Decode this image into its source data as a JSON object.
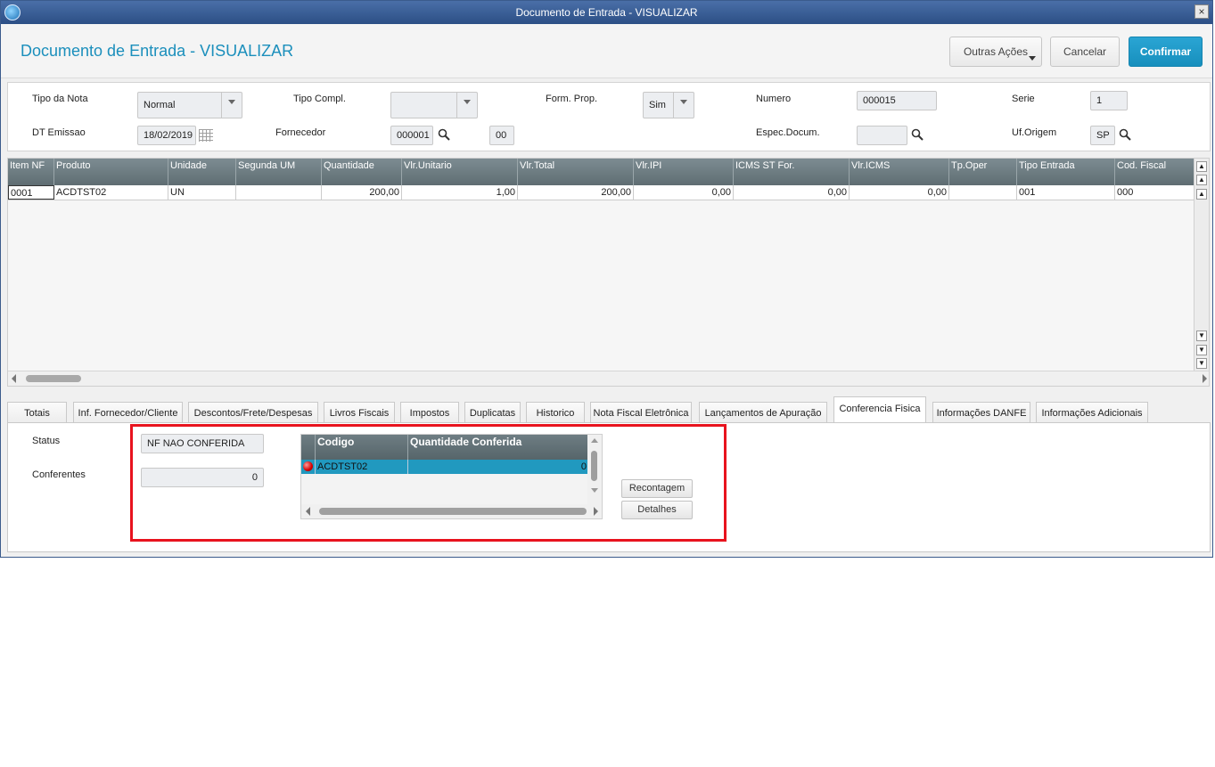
{
  "window": {
    "title": "Documento de Entrada - VISUALIZAR",
    "close_glyph": "×"
  },
  "header": {
    "title": "Documento de Entrada - VISUALIZAR",
    "buttons": {
      "other": "Outras Ações",
      "cancel": "Cancelar",
      "confirm": "Confirmar"
    }
  },
  "form": {
    "tipo_nota": {
      "label": "Tipo da Nota",
      "value": "Normal"
    },
    "tipo_compl": {
      "label": "Tipo Compl.",
      "value": ""
    },
    "form_prop": {
      "label": "Form. Prop.",
      "value": "Sim"
    },
    "numero": {
      "label": "Numero",
      "value": "000015"
    },
    "serie": {
      "label": "Serie",
      "value": "1"
    },
    "dt_emissao": {
      "label": "DT Emissao",
      "value": "18/02/2019"
    },
    "fornecedor": {
      "label": "Fornecedor",
      "value": "000001",
      "loja": "00"
    },
    "espec_docum": {
      "label": "Espec.Docum.",
      "value": ""
    },
    "uf_origem": {
      "label": "Uf.Origem",
      "value": "SP"
    }
  },
  "items_grid": {
    "columns": [
      "Item NF",
      "Produto",
      "Unidade",
      "Segunda UM",
      "Quantidade",
      "Vlr.Unitario",
      "Vlr.Total",
      "Vlr.IPI",
      "ICMS ST For.",
      "Vlr.ICMS",
      "Tp.Oper",
      "Tipo Entrada",
      "Cod. Fiscal"
    ],
    "rows": [
      [
        "0001",
        "ACDTST02",
        "UN",
        "",
        "200,00",
        "1,00",
        "200,00",
        "0,00",
        "0,00",
        "0,00",
        "",
        "001",
        "000"
      ]
    ]
  },
  "tabs": [
    "Totais",
    "Inf. Fornecedor/Cliente",
    "Descontos/Frete/Despesas",
    "Livros Fiscais",
    "Impostos",
    "Duplicatas",
    "Historico",
    "Nota Fiscal Eletrônica",
    "Lançamentos de Apuração",
    "Conferencia Fisica",
    "Informações DANFE",
    "Informações Adicionais"
  ],
  "active_tab": "Conferencia Fisica",
  "conferencia": {
    "status_label": "Status",
    "status_value": "NF NAO CONFERIDA",
    "conferentes_label": "Conferentes",
    "conferentes_value": "0",
    "grid_columns": [
      "Codigo",
      "Quantidade Conferida"
    ],
    "grid_rows": [
      {
        "codigo": "ACDTST02",
        "qtd": "0"
      }
    ],
    "buttons": {
      "recontagem": "Recontagem",
      "detalhes": "Detalhes"
    }
  },
  "colors": {
    "accent": "#1b8fbc",
    "highlight_border": "#e8131e",
    "selected_row": "#2199bf"
  }
}
